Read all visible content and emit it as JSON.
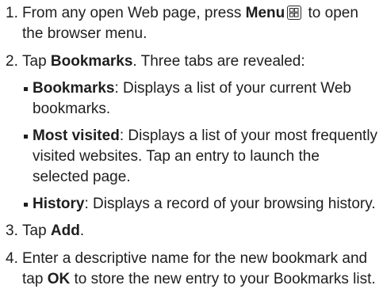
{
  "steps": [
    {
      "number": "1.",
      "text_before": "From any open Web page, press ",
      "bold": "Menu",
      "icon": "menu-key-icon",
      "text_after": " to open the browser menu."
    },
    {
      "number": "2.",
      "text_before": "Tap ",
      "bold": "Bookmarks",
      "text_after": ". Three tabs are revealed:",
      "sub_items": [
        {
          "bold": "Bookmarks",
          "text": ": Displays a list of your current Web bookmarks."
        },
        {
          "bold": "Most visited",
          "text": ": Displays a list of your most frequently visited websites. Tap an entry to launch the selected page."
        },
        {
          "bold": "History",
          "text": ": Displays a record of your browsing history."
        }
      ]
    },
    {
      "number": "3.",
      "text_before": "Tap ",
      "bold": "Add",
      "text_after": "."
    },
    {
      "number": "4.",
      "text_before": "Enter a descriptive name for the new bookmark and tap ",
      "bold": "OK",
      "text_after": " to store the new entry to your Bookmarks list."
    }
  ]
}
